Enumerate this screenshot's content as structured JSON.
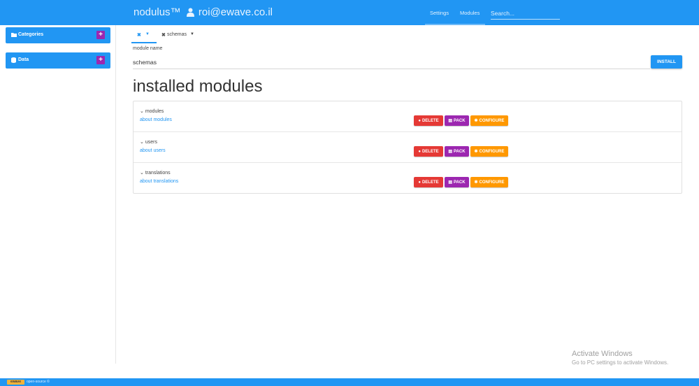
{
  "header": {
    "brand": "nodulus™",
    "user_email": "roi@ewave.co.il",
    "nav_settings": "Settings",
    "nav_modules": "Modules",
    "search_placeholder": "Search..."
  },
  "sidebar": {
    "categories_label": "Categories",
    "data_label": "Data",
    "add_symbol": "+"
  },
  "tabs": {
    "close_symbol": "✖",
    "caret_symbol": "▼",
    "second_tab_label": "schemas"
  },
  "form": {
    "label": "module name",
    "value": "schemas",
    "install_label": "INSTALL"
  },
  "page": {
    "heading": "installed modules"
  },
  "modules": [
    {
      "name": "modules",
      "about": "about modules"
    },
    {
      "name": "users",
      "about": "about users"
    },
    {
      "name": "translations",
      "about": "about translations"
    }
  ],
  "module_actions": {
    "delete": "DELETE",
    "pack": "PACK",
    "configure": "CONFIGURE",
    "chevron": "⌄"
  },
  "watermark": {
    "title": "Activate Windows",
    "subtitle": "Go to PC settings to activate Windows."
  },
  "footer": {
    "logo": "ewave",
    "text": "open-source ©"
  },
  "colors": {
    "primary": "#2196f3",
    "purple": "#9c27b0",
    "delete": "#e53935",
    "configure": "#ff9800"
  }
}
